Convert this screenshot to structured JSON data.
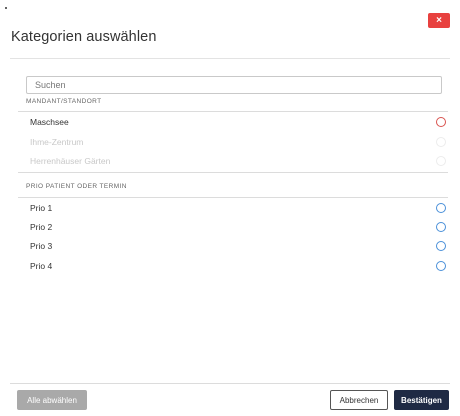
{
  "dialog": {
    "title": "Kategorien auswählen",
    "close_label": "×",
    "search": {
      "placeholder": "Suchen",
      "value": ""
    },
    "sections": [
      {
        "heading": "MANDANT/STANDORT",
        "options": [
          {
            "label": "Maschsee",
            "state": "enabled",
            "selected": false
          },
          {
            "label": "Ihme-Zentrum",
            "state": "disabled",
            "selected": false
          },
          {
            "label": "Herrenhäuser Gärten",
            "state": "disabled",
            "selected": false
          }
        ]
      },
      {
        "heading": "PRIO PATIENT ODER TERMIN",
        "options": [
          {
            "label": "Prio 1",
            "state": "enabled",
            "selected": false
          },
          {
            "label": "Prio 2",
            "state": "enabled",
            "selected": false
          },
          {
            "label": "Prio 3",
            "state": "enabled",
            "selected": false
          },
          {
            "label": "Prio 4",
            "state": "enabled",
            "selected": false
          }
        ]
      }
    ],
    "footer": {
      "clear_all": "Alle abwählen",
      "cancel": "Abbrechen",
      "confirm": "Bestätigen"
    }
  },
  "colors": {
    "close_button": "#e8413f",
    "radio_blue": "#4a90d9",
    "radio_red": "#d9534f",
    "confirm_button": "#1f2a44",
    "clear_button": "#a9a9a9"
  }
}
